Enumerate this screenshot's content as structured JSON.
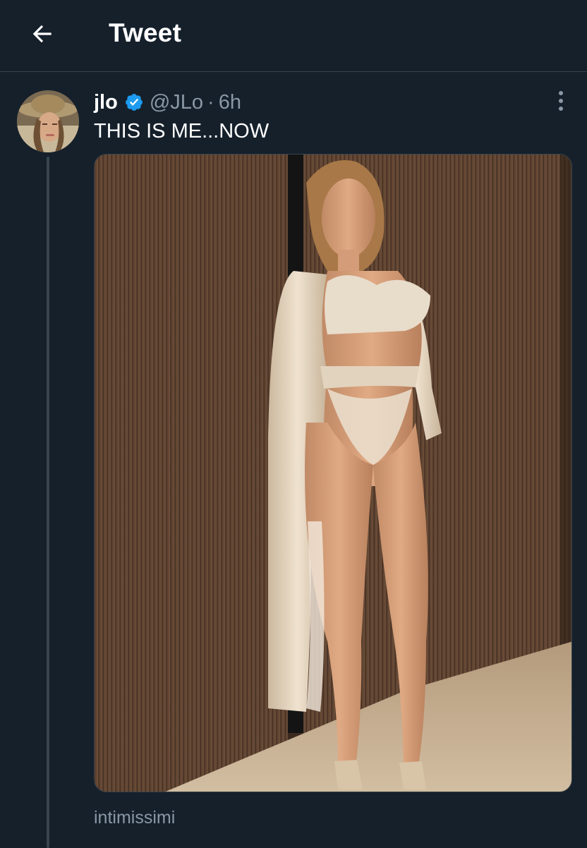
{
  "header": {
    "title": "Tweet",
    "back_icon": "arrow-left-icon"
  },
  "tweet": {
    "display_name": "jlo",
    "verified_icon": "verified-badge-icon",
    "verified_color": "#1d9bf0",
    "handle": "@JLo",
    "separator": "·",
    "timestamp": "6h",
    "more_icon": "more-vertical-icon",
    "text": "THIS IS ME...NOW",
    "media_tag": "intimissimi"
  },
  "colors": {
    "background": "#15202b",
    "divider": "#38444d",
    "secondary_text": "#8b98a5",
    "primary_text": "#ffffff"
  }
}
